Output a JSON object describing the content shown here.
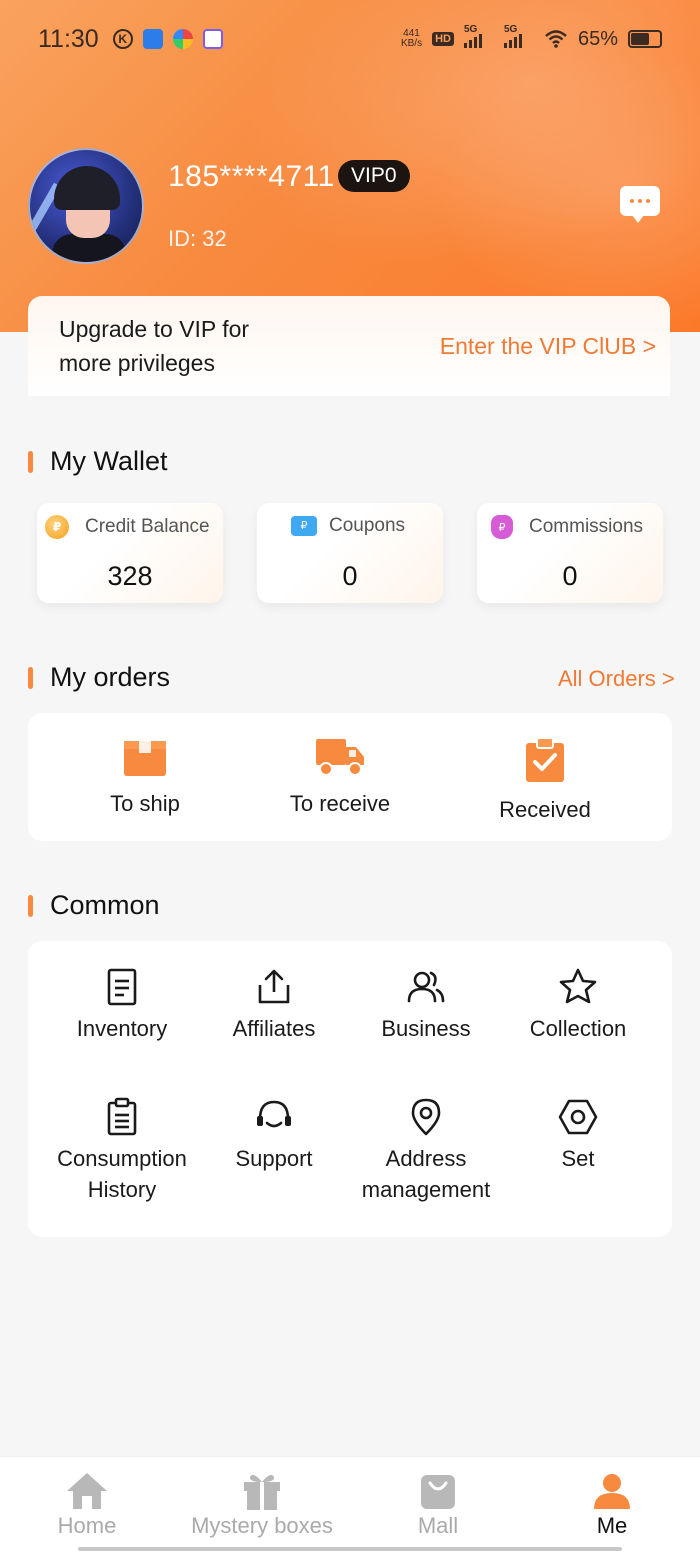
{
  "status_bar": {
    "time": "11:30",
    "net_speed_value": "441",
    "net_speed_unit": "KB/s",
    "hd_label": "HD",
    "signal1_label": "5G",
    "signal2_label": "5G",
    "battery": "65%"
  },
  "profile": {
    "phone": "185****4711",
    "vip_level": "VIP0",
    "id_label": "ID:",
    "id_value": "32"
  },
  "vip_banner": {
    "upgrade_text": "Upgrade to VIP for more privileges",
    "enter_link": "Enter the VIP ClUB >"
  },
  "wallet": {
    "title": "My Wallet",
    "cards": [
      {
        "label": "Credit Balance",
        "value": "328",
        "icon": "coin-icon"
      },
      {
        "label": "Coupons",
        "value": "0",
        "icon": "coupon-icon"
      },
      {
        "label": "Commissions",
        "value": "0",
        "icon": "money-bag-icon"
      }
    ]
  },
  "orders": {
    "title": "My orders",
    "all_link": "All Orders >",
    "items": [
      {
        "label": "To ship",
        "icon": "package-icon"
      },
      {
        "label": "To receive",
        "icon": "truck-icon"
      },
      {
        "label": "Received",
        "icon": "clipboard-check-icon"
      }
    ]
  },
  "common": {
    "title": "Common",
    "items": [
      {
        "label": "Inventory",
        "icon": "document-icon"
      },
      {
        "label": "Affiliates",
        "icon": "share-icon"
      },
      {
        "label": "Business",
        "icon": "users-icon"
      },
      {
        "label": "Collection",
        "icon": "star-icon"
      },
      {
        "label": "Consumption History",
        "icon": "clipboard-list-icon"
      },
      {
        "label": "Support",
        "icon": "headset-icon"
      },
      {
        "label": "Address management",
        "icon": "location-pin-icon"
      },
      {
        "label": "Set",
        "icon": "hexagon-nut-icon"
      }
    ]
  },
  "tabbar": {
    "items": [
      {
        "label": "Home",
        "icon": "home-icon",
        "active": false
      },
      {
        "label": "Mystery boxes",
        "icon": "gift-icon",
        "active": false
      },
      {
        "label": "Mall",
        "icon": "shopping-bag-icon",
        "active": false
      },
      {
        "label": "Me",
        "icon": "person-icon",
        "active": true
      }
    ]
  },
  "colors": {
    "accent": "#F88A3F",
    "link": "#F07A35",
    "vip_badge_bg": "#1C1410",
    "tab_inactive": "#AAAAAA"
  },
  "battery_level": 0.65
}
